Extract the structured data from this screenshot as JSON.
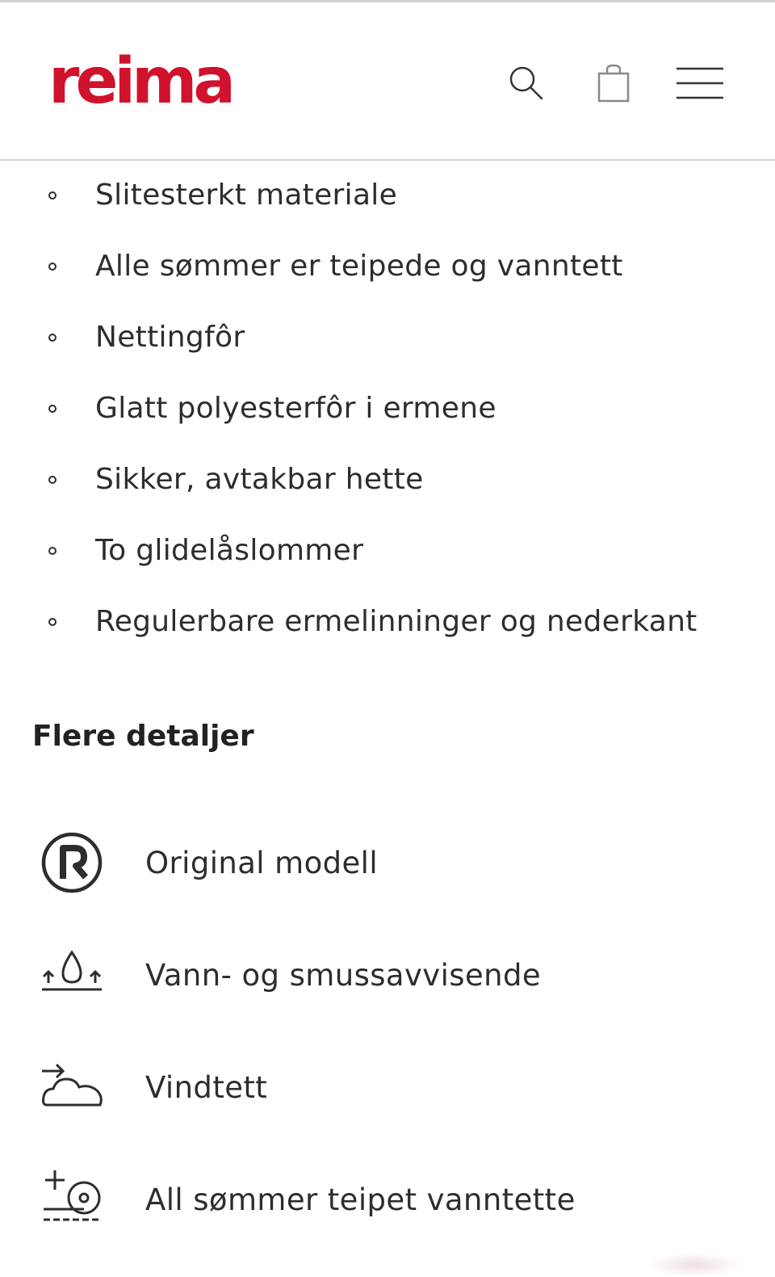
{
  "header": {
    "logo_text": "reima",
    "brand_color": "#d0122c",
    "icons": [
      "search-icon",
      "shopping-bag-icon",
      "hamburger-menu-icon"
    ]
  },
  "features": [
    {
      "label": "Slitesterkt materiale"
    },
    {
      "label": "Alle sømmer er teipede og vanntett"
    },
    {
      "label": "Nettingfôr"
    },
    {
      "label": "Glatt polyesterfôr i ermene"
    },
    {
      "label": "Sikker, avtakbar hette"
    },
    {
      "label": "To glidelåslommer"
    },
    {
      "label": "Regulerbare ermelinninger og nederkant"
    }
  ],
  "details": {
    "title": "Flere detaljer",
    "items": [
      {
        "icon": "original-model-icon",
        "label": "Original modell"
      },
      {
        "icon": "water-repellent-icon",
        "label": "Vann- og smussavvisende"
      },
      {
        "icon": "windproof-icon",
        "label": "Vindtett"
      },
      {
        "icon": "taped-seams-icon",
        "label": "All sømmer teipet vanntette"
      }
    ]
  }
}
